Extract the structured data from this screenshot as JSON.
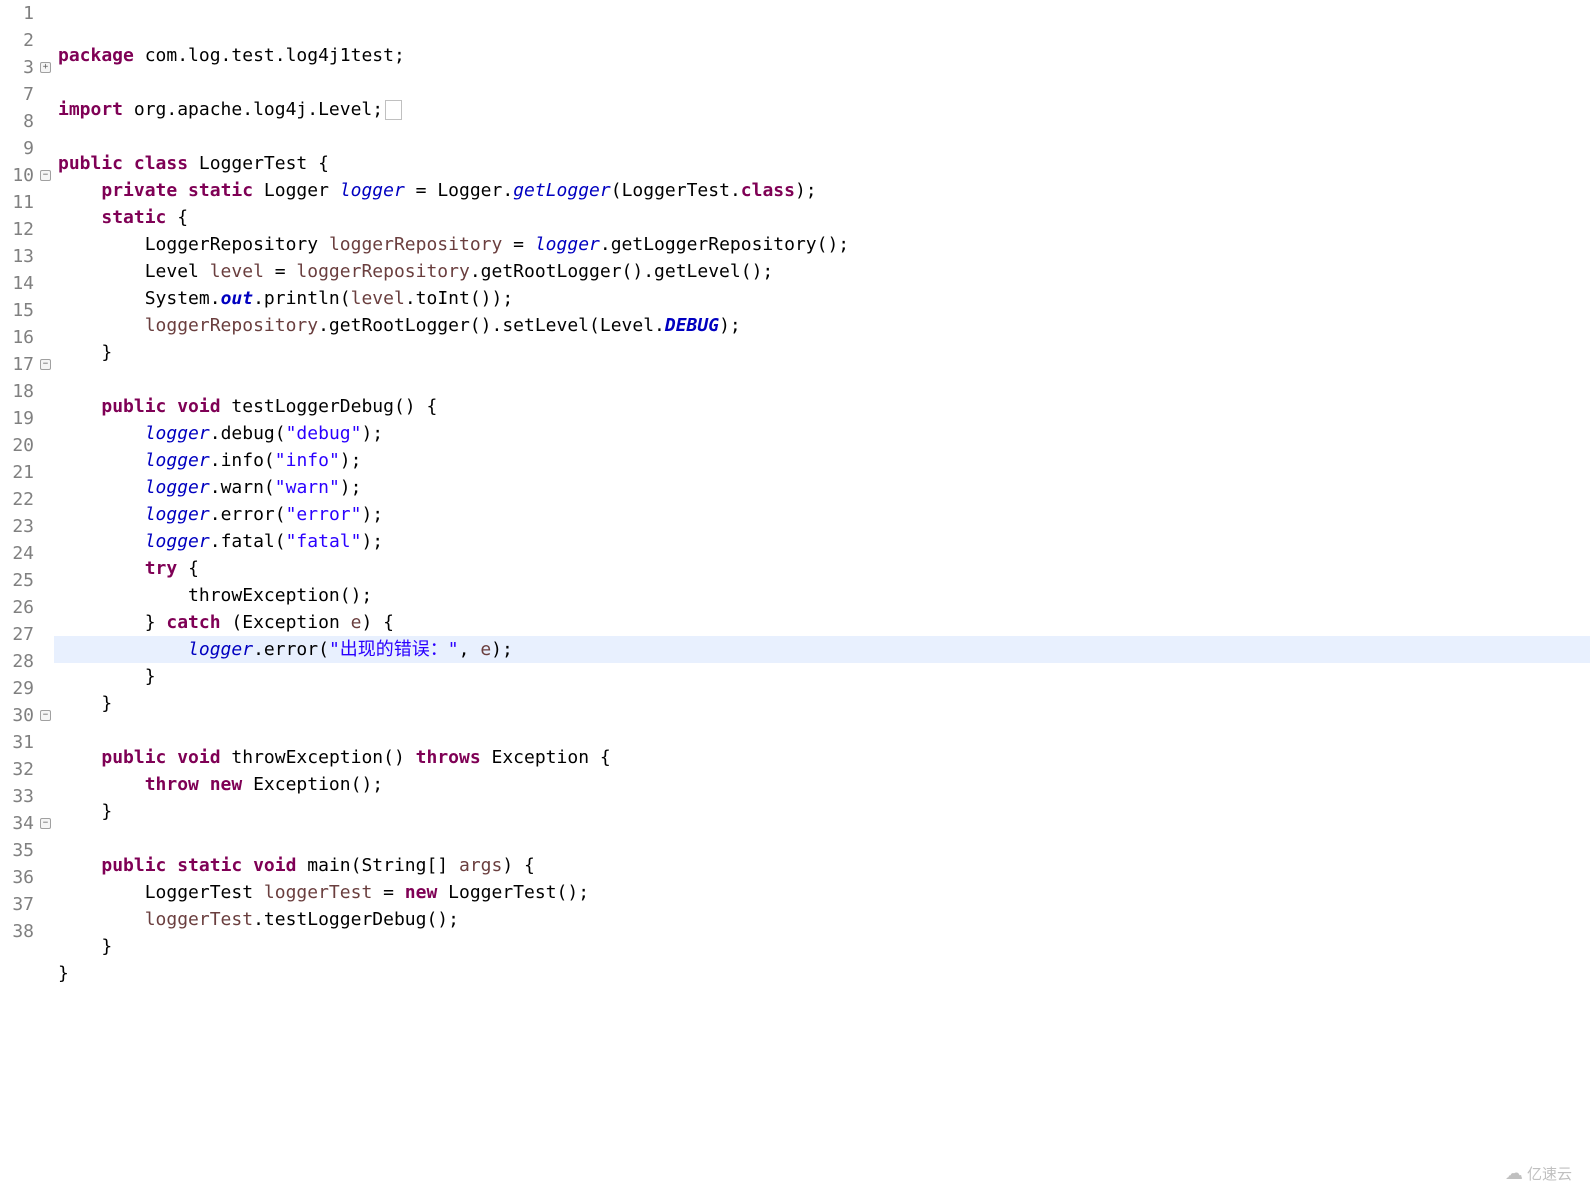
{
  "watermark": "亿速云",
  "lines": [
    {
      "num": 1,
      "fold": null,
      "highlight": false,
      "tokens": [
        {
          "t": "package ",
          "c": "kw"
        },
        {
          "t": "com.log.test.log4j1test;",
          "c": "punct"
        }
      ]
    },
    {
      "num": 2,
      "fold": null,
      "highlight": false,
      "tokens": []
    },
    {
      "num": 3,
      "fold": "plus",
      "highlight": false,
      "tokens": [
        {
          "t": "import ",
          "c": "kw"
        },
        {
          "t": "org.apache.log4j.Level;",
          "c": "punct"
        }
      ],
      "collapsed": true
    },
    {
      "num": 7,
      "fold": null,
      "highlight": false,
      "tokens": []
    },
    {
      "num": 8,
      "fold": null,
      "highlight": false,
      "tokens": [
        {
          "t": "public class ",
          "c": "kw"
        },
        {
          "t": "LoggerTest {",
          "c": "punct"
        }
      ]
    },
    {
      "num": 9,
      "fold": null,
      "highlight": false,
      "tokens": [
        {
          "t": "    ",
          "c": "punct"
        },
        {
          "t": "private static ",
          "c": "kw"
        },
        {
          "t": "Logger ",
          "c": "type"
        },
        {
          "t": "logger",
          "c": "field-static"
        },
        {
          "t": " = Logger.",
          "c": "punct"
        },
        {
          "t": "getLogger",
          "c": "field-static"
        },
        {
          "t": "(LoggerTest.",
          "c": "punct"
        },
        {
          "t": "class",
          "c": "kw"
        },
        {
          "t": ");",
          "c": "punct"
        }
      ]
    },
    {
      "num": 10,
      "fold": "minus",
      "highlight": false,
      "tokens": [
        {
          "t": "    ",
          "c": "punct"
        },
        {
          "t": "static ",
          "c": "kw"
        },
        {
          "t": "{",
          "c": "punct"
        }
      ]
    },
    {
      "num": 11,
      "fold": null,
      "highlight": false,
      "tokens": [
        {
          "t": "        LoggerRepository ",
          "c": "punct"
        },
        {
          "t": "loggerRepository",
          "c": "var"
        },
        {
          "t": " = ",
          "c": "punct"
        },
        {
          "t": "logger",
          "c": "field-static"
        },
        {
          "t": ".getLoggerRepository();",
          "c": "punct"
        }
      ]
    },
    {
      "num": 12,
      "fold": null,
      "highlight": false,
      "tokens": [
        {
          "t": "        Level ",
          "c": "punct"
        },
        {
          "t": "level",
          "c": "var"
        },
        {
          "t": " = ",
          "c": "punct"
        },
        {
          "t": "loggerRepository",
          "c": "var"
        },
        {
          "t": ".getRootLogger().getLevel();",
          "c": "punct"
        }
      ]
    },
    {
      "num": 13,
      "fold": null,
      "highlight": false,
      "tokens": [
        {
          "t": "        System.",
          "c": "punct"
        },
        {
          "t": "out",
          "c": "field-static-final"
        },
        {
          "t": ".println(",
          "c": "punct"
        },
        {
          "t": "level",
          "c": "var"
        },
        {
          "t": ".toInt());",
          "c": "punct"
        }
      ]
    },
    {
      "num": 14,
      "fold": null,
      "highlight": false,
      "tokens": [
        {
          "t": "        ",
          "c": "punct"
        },
        {
          "t": "loggerRepository",
          "c": "var"
        },
        {
          "t": ".getRootLogger().setLevel(Level.",
          "c": "punct"
        },
        {
          "t": "DEBUG",
          "c": "field-static-final"
        },
        {
          "t": ");",
          "c": "punct"
        }
      ]
    },
    {
      "num": 15,
      "fold": null,
      "highlight": false,
      "tokens": [
        {
          "t": "    }",
          "c": "punct"
        }
      ]
    },
    {
      "num": 16,
      "fold": null,
      "highlight": false,
      "tokens": []
    },
    {
      "num": 17,
      "fold": "minus",
      "highlight": false,
      "tokens": [
        {
          "t": "    ",
          "c": "punct"
        },
        {
          "t": "public void ",
          "c": "kw"
        },
        {
          "t": "testLoggerDebug() {",
          "c": "punct"
        }
      ]
    },
    {
      "num": 18,
      "fold": null,
      "highlight": false,
      "tokens": [
        {
          "t": "        ",
          "c": "punct"
        },
        {
          "t": "logger",
          "c": "field-static"
        },
        {
          "t": ".debug(",
          "c": "punct"
        },
        {
          "t": "\"debug\"",
          "c": "str"
        },
        {
          "t": ");",
          "c": "punct"
        }
      ]
    },
    {
      "num": 19,
      "fold": null,
      "highlight": false,
      "tokens": [
        {
          "t": "        ",
          "c": "punct"
        },
        {
          "t": "logger",
          "c": "field-static"
        },
        {
          "t": ".info(",
          "c": "punct"
        },
        {
          "t": "\"info\"",
          "c": "str"
        },
        {
          "t": ");",
          "c": "punct"
        }
      ]
    },
    {
      "num": 20,
      "fold": null,
      "highlight": false,
      "tokens": [
        {
          "t": "        ",
          "c": "punct"
        },
        {
          "t": "logger",
          "c": "field-static"
        },
        {
          "t": ".warn(",
          "c": "punct"
        },
        {
          "t": "\"warn\"",
          "c": "str"
        },
        {
          "t": ");",
          "c": "punct"
        }
      ]
    },
    {
      "num": 21,
      "fold": null,
      "highlight": false,
      "tokens": [
        {
          "t": "        ",
          "c": "punct"
        },
        {
          "t": "logger",
          "c": "field-static"
        },
        {
          "t": ".error(",
          "c": "punct"
        },
        {
          "t": "\"error\"",
          "c": "str"
        },
        {
          "t": ");",
          "c": "punct"
        }
      ]
    },
    {
      "num": 22,
      "fold": null,
      "highlight": false,
      "tokens": [
        {
          "t": "        ",
          "c": "punct"
        },
        {
          "t": "logger",
          "c": "field-static"
        },
        {
          "t": ".fatal(",
          "c": "punct"
        },
        {
          "t": "\"fatal\"",
          "c": "str"
        },
        {
          "t": ");",
          "c": "punct"
        }
      ]
    },
    {
      "num": 23,
      "fold": null,
      "highlight": false,
      "tokens": [
        {
          "t": "        ",
          "c": "punct"
        },
        {
          "t": "try ",
          "c": "kw"
        },
        {
          "t": "{",
          "c": "punct"
        }
      ]
    },
    {
      "num": 24,
      "fold": null,
      "highlight": false,
      "tokens": [
        {
          "t": "            throwException();",
          "c": "punct"
        }
      ]
    },
    {
      "num": 25,
      "fold": null,
      "highlight": false,
      "tokens": [
        {
          "t": "        } ",
          "c": "punct"
        },
        {
          "t": "catch ",
          "c": "kw"
        },
        {
          "t": "(Exception ",
          "c": "punct"
        },
        {
          "t": "e",
          "c": "var"
        },
        {
          "t": ") {",
          "c": "punct"
        }
      ]
    },
    {
      "num": 26,
      "fold": null,
      "highlight": true,
      "tokens": [
        {
          "t": "            ",
          "c": "punct"
        },
        {
          "t": "logger",
          "c": "field-static"
        },
        {
          "t": ".error(",
          "c": "punct"
        },
        {
          "t": "\"出现的错误：\"",
          "c": "str"
        },
        {
          "t": ", ",
          "c": "punct"
        },
        {
          "t": "e",
          "c": "var"
        },
        {
          "t": ");",
          "c": "punct"
        }
      ]
    },
    {
      "num": 27,
      "fold": null,
      "highlight": false,
      "tokens": [
        {
          "t": "        }",
          "c": "punct"
        }
      ]
    },
    {
      "num": 28,
      "fold": null,
      "highlight": false,
      "tokens": [
        {
          "t": "    }",
          "c": "punct"
        }
      ]
    },
    {
      "num": 29,
      "fold": null,
      "highlight": false,
      "tokens": []
    },
    {
      "num": 30,
      "fold": "minus",
      "highlight": false,
      "tokens": [
        {
          "t": "    ",
          "c": "punct"
        },
        {
          "t": "public void ",
          "c": "kw"
        },
        {
          "t": "throwException() ",
          "c": "punct"
        },
        {
          "t": "throws ",
          "c": "kw"
        },
        {
          "t": "Exception {",
          "c": "punct"
        }
      ]
    },
    {
      "num": 31,
      "fold": null,
      "highlight": false,
      "tokens": [
        {
          "t": "        ",
          "c": "punct"
        },
        {
          "t": "throw new ",
          "c": "kw"
        },
        {
          "t": "Exception();",
          "c": "punct"
        }
      ]
    },
    {
      "num": 32,
      "fold": null,
      "highlight": false,
      "tokens": [
        {
          "t": "    }",
          "c": "punct"
        }
      ]
    },
    {
      "num": 33,
      "fold": null,
      "highlight": false,
      "tokens": []
    },
    {
      "num": 34,
      "fold": "minus",
      "highlight": false,
      "tokens": [
        {
          "t": "    ",
          "c": "punct"
        },
        {
          "t": "public static void ",
          "c": "kw"
        },
        {
          "t": "main(String[] ",
          "c": "punct"
        },
        {
          "t": "args",
          "c": "var"
        },
        {
          "t": ") {",
          "c": "punct"
        }
      ]
    },
    {
      "num": 35,
      "fold": null,
      "highlight": false,
      "tokens": [
        {
          "t": "        LoggerTest ",
          "c": "punct"
        },
        {
          "t": "loggerTest",
          "c": "var"
        },
        {
          "t": " = ",
          "c": "punct"
        },
        {
          "t": "new ",
          "c": "kw"
        },
        {
          "t": "LoggerTest();",
          "c": "punct"
        }
      ]
    },
    {
      "num": 36,
      "fold": null,
      "highlight": false,
      "tokens": [
        {
          "t": "        ",
          "c": "punct"
        },
        {
          "t": "loggerTest",
          "c": "var"
        },
        {
          "t": ".testLoggerDebug();",
          "c": "punct"
        }
      ]
    },
    {
      "num": 37,
      "fold": null,
      "highlight": false,
      "tokens": [
        {
          "t": "    }",
          "c": "punct"
        }
      ]
    },
    {
      "num": 38,
      "fold": null,
      "highlight": false,
      "tokens": [
        {
          "t": "}",
          "c": "punct"
        }
      ]
    }
  ]
}
